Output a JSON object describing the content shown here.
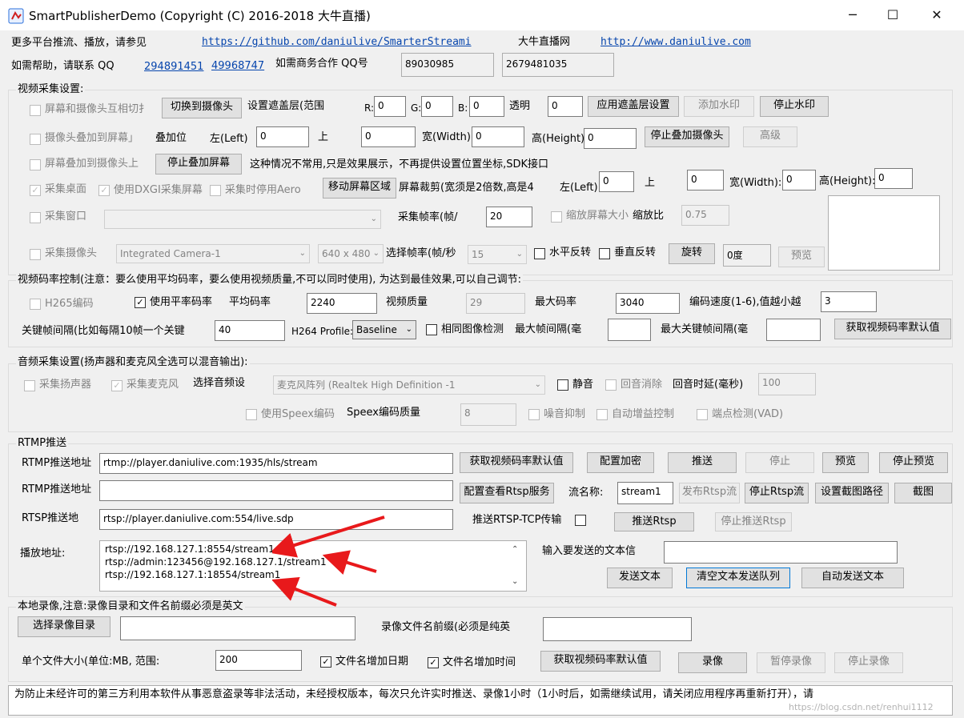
{
  "window": {
    "title": "SmartPublisherDemo  (Copyright (C) 2016-2018 大牛直播)",
    "min": "─",
    "max": "☐",
    "close": "✕"
  },
  "header": {
    "more_text": "更多平台推流、播放，请参见",
    "github_url": "https://github.com/daniulive/SmarterStreami",
    "brand": "大牛直播网",
    "site_url": "http://www.daniulive.com",
    "help_text": "如需帮助，请联系 QQ",
    "qq1": "294891451",
    "qq2": "49968747",
    "biz_text": "如需商务合作 QQ号",
    "biz_qq1": "89030985",
    "biz_qq2": "2679481035"
  },
  "video": {
    "title": "视频采集设置:",
    "cb_overlay_switch": "屏幕和摄像头互相切扌",
    "btn_switch_cam": "切换到摄像头",
    "mask_range": "设置遮盖层(范围",
    "r": "R:",
    "r_val": "0",
    "g": "G:",
    "g_val": "0",
    "b": "B:",
    "b_val": "0",
    "alpha": "透明",
    "alpha_val": "0",
    "btn_apply_mask": "应用遮盖层设置",
    "btn_add_wm": "添加水印",
    "btn_stop_wm": "停止水印",
    "cb_cam_on_screen": "摄像头叠加到屏幕」",
    "overlay_pos": "叠加位",
    "left_lbl": "左(Left)",
    "left_val": "0",
    "up_lbl": "上",
    "up_val": "0",
    "w_lbl": "宽(Width)",
    "w_val": "0",
    "h_lbl": "高(Height)",
    "h_val": "0",
    "btn_stop_overlay_cam": "停止叠加摄像头",
    "btn_advanced": "高级",
    "cb_screen_on_cam": "屏幕叠加到摄像头上",
    "btn_stop_overlay_screen": "停止叠加屏幕",
    "note_uncommon": "这种情况不常用,只是效果展示，不再提供设置位置坐标,SDK接口",
    "cb_desktop": "采集桌面",
    "cb_dxgi": "使用DXGI采集屏幕",
    "cb_aero": "采集时停用Aero",
    "btn_move_region": "移动屏幕区域",
    "crop_lbl": "屏幕裁剪(宽须是2倍数,高是4",
    "crop_left": "左(Left):",
    "crop_left_val": "0",
    "crop_up": "上",
    "crop_up_val": "0",
    "crop_w": "宽(Width):",
    "crop_w_val": "0",
    "crop_h": "高(Height):",
    "crop_h_val": "0",
    "cb_window": "采集窗口",
    "fps_lbl": "采集帧率(帧/",
    "fps_val": "20",
    "cb_scale": "缩放屏幕大小",
    "scale_lbl": "缩放比",
    "scale_val": "0.75",
    "cb_camera": "采集摄像头",
    "camera_sel": "Integrated Camera-1",
    "res_sel": "640 x 480",
    "sel_fps_lbl": "选择帧率(帧/秒",
    "sel_fps_val": "15",
    "cb_hflip": "水平反转",
    "cb_vflip": "垂直反转",
    "btn_rotate": "旋转",
    "rotate_val": "0度",
    "btn_preview": "预览"
  },
  "bitrate": {
    "title": "视频码率控制(注意：要么使用平均码率，要么使用视频质量,不可以同时使用), 为达到最佳效果,可以自己调节:",
    "cb_h265": "H265编码",
    "cb_avg": "使用平率码率",
    "avg_lbl": "平均码率",
    "avg_val": "2240",
    "quality_lbl": "视频质量",
    "quality_val": "29",
    "max_lbl": "最大码率",
    "max_val": "3040",
    "speed_lbl": "编码速度(1-6),值越小越",
    "speed_val": "3",
    "gop_lbl": "关键帧间隔(比如每隔10帧一个关键",
    "gop_val": "40",
    "profile_lbl": "H264 Profile:",
    "profile_val": "Baseline",
    "cb_same_img": "相同图像检测",
    "max_frame_lbl": "最大帧间隔(毫",
    "max_key_lbl": "最大关键帧间隔(毫",
    "btn_default": "获取视频码率默认值"
  },
  "audio": {
    "title": "音频采集设置(扬声器和麦克风全选可以混音输出):",
    "cb_speaker": "采集扬声器",
    "cb_mic": "采集麦克风",
    "sel_lbl": "选择音频设",
    "mic_sel": "麦克风阵列 (Realtek High Definition -1",
    "cb_mute": "静音",
    "cb_echo": "回音消除",
    "echo_delay": "回音时延(毫秒)",
    "echo_val": "100",
    "cb_speex": "使用Speex编码",
    "speex_q": "Speex编码质量",
    "speex_val": "8",
    "cb_ns": "噪音抑制",
    "cb_agc": "自动增益控制",
    "cb_vad": "端点检测(VAD)"
  },
  "rtmp": {
    "title": "RTMP推送",
    "url_lbl": "RTMP推送地址",
    "url_val": "rtmp://player.daniulive.com:1935/hls/stream",
    "btn_default": "获取视频码率默认值",
    "btn_encrypt": "配置加密",
    "btn_push": "推送",
    "btn_stop": "停止",
    "btn_preview": "预览",
    "btn_stop_preview": "停止预览",
    "url2_lbl": "RTMP推送地址",
    "btn_rtsp_svc": "配置查看Rtsp服务",
    "stream_lbl": "流名称:",
    "stream_val": "stream1",
    "btn_pub_rtsp": "发布Rtsp流",
    "btn_stop_rtsp": "停止Rtsp流",
    "btn_snap_path": "设置截图路径",
    "btn_snap": "截图",
    "rtsp_lbl": "RTSP推送地",
    "rtsp_val": "rtsp://player.daniulive.com:554/live.sdp",
    "tcp_lbl": "推送RTSP-TCP传输",
    "btn_push_rtsp": "推送Rtsp",
    "btn_stop_push_rtsp": "停止推送Rtsp",
    "play_lbl": "播放地址:",
    "play_urls": [
      "rtsp://192.168.127.1:8554/stream1",
      "rtsp://admin:123456@192.168.127.1/stream1",
      "rtsp://192.168.127.1:18554/stream1"
    ],
    "text_lbl": "输入要发送的文本信",
    "btn_send_text": "发送文本",
    "btn_clear_queue": "清空文本发送队列",
    "btn_auto_send": "自动发送文本"
  },
  "record": {
    "title": "本地录像,注意:录像目录和文件名前缀必须是英文",
    "btn_dir": "选择录像目录",
    "prefix_lbl": "录像文件名前缀(必须是纯英",
    "size_lbl": "单个文件大小(单位:MB, 范围:",
    "size_val": "200",
    "cb_date": "文件名增加日期",
    "cb_time": "文件名增加时间",
    "btn_default": "获取视频码率默认值",
    "btn_record": "录像",
    "btn_pause": "暂停录像",
    "btn_stop": "停止录像"
  },
  "status": {
    "text": "为防止未经许可的第三方利用本软件从事恶意盗录等非法活动，未经授权版本，每次只允许实时推送、录像1小时（1小时后，如需继续试用，请关闭应用程序再重新打开），请",
    "watermark": "https://blog.csdn.net/renhui1112"
  },
  "colors": {
    "arrow": "#e8191b",
    "link": "#0645ad"
  }
}
